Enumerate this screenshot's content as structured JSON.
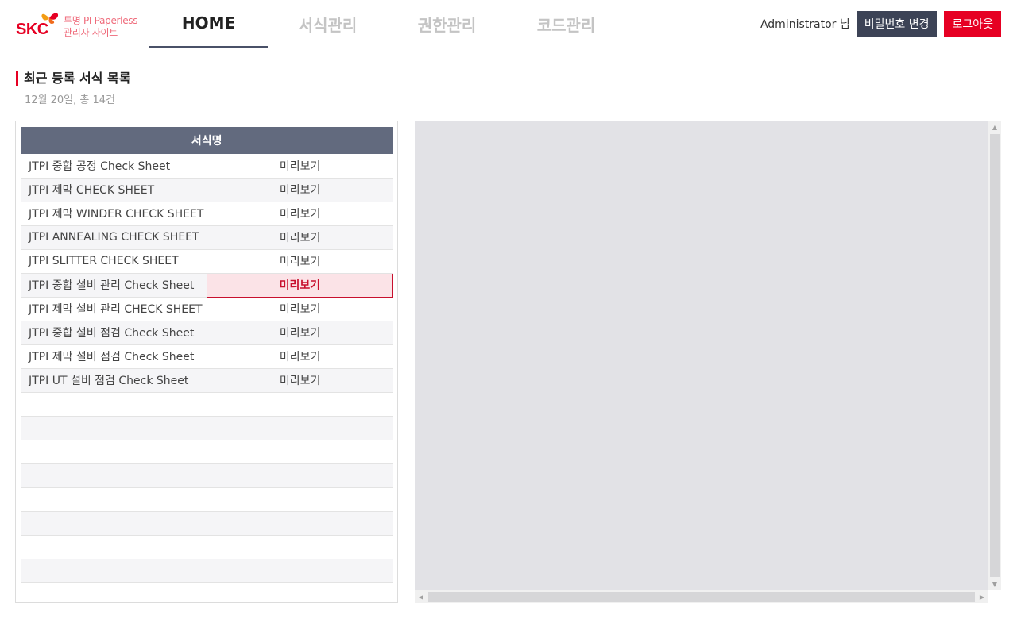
{
  "header": {
    "logo_brand": "SKC",
    "logo_line1": "투명 PI Paperless",
    "logo_line2": "관리자 사이트",
    "tabs": [
      {
        "label": "HOME",
        "active": true
      },
      {
        "label": "서식관리",
        "active": false
      },
      {
        "label": "권한관리",
        "active": false
      },
      {
        "label": "코드관리",
        "active": false
      }
    ],
    "user_name": "Administrator 님",
    "change_password_label": "비밀번호 변경",
    "logout_label": "로그아웃"
  },
  "section": {
    "title": "최근 등록 서식 목록",
    "subtitle": "12월 20일, 총 14건"
  },
  "list": {
    "column_header": "서식명",
    "rows": [
      {
        "name": "JTPI 중합 공정 Check Sheet",
        "action": "미리보기",
        "selected": false
      },
      {
        "name": "JTPI 제막 CHECK SHEET",
        "action": "미리보기",
        "selected": false
      },
      {
        "name": "JTPI 제막 WINDER CHECK SHEET",
        "action": "미리보기",
        "selected": false
      },
      {
        "name": "JTPI ANNEALING CHECK SHEET",
        "action": "미리보기",
        "selected": false
      },
      {
        "name": "JTPI SLITTER CHECK SHEET",
        "action": "미리보기",
        "selected": false
      },
      {
        "name": "JTPI 중합 설비 관리 Check Sheet",
        "action": "미리보기",
        "selected": true
      },
      {
        "name": "JTPI 제막 설비 관리 CHECK SHEET",
        "action": "미리보기",
        "selected": false
      },
      {
        "name": "JTPI 중합 설비 점검 Check Sheet",
        "action": "미리보기",
        "selected": false
      },
      {
        "name": "JTPI 제막 설비 점검 Check Sheet",
        "action": "미리보기",
        "selected": false
      },
      {
        "name": "JTPI UT 설비 점검 Check Sheet",
        "action": "미리보기",
        "selected": false
      }
    ],
    "empty_rows": 9
  },
  "colors": {
    "accent_red": "#e60023",
    "header_gray": "#626a7e",
    "dark_button": "#3c4356"
  },
  "icons": {
    "logo": "skc-butterfly-logo",
    "scroll_up": "scroll-up-icon",
    "scroll_down": "scroll-down-icon",
    "scroll_left": "scroll-left-icon",
    "scroll_right": "scroll-right-icon"
  }
}
